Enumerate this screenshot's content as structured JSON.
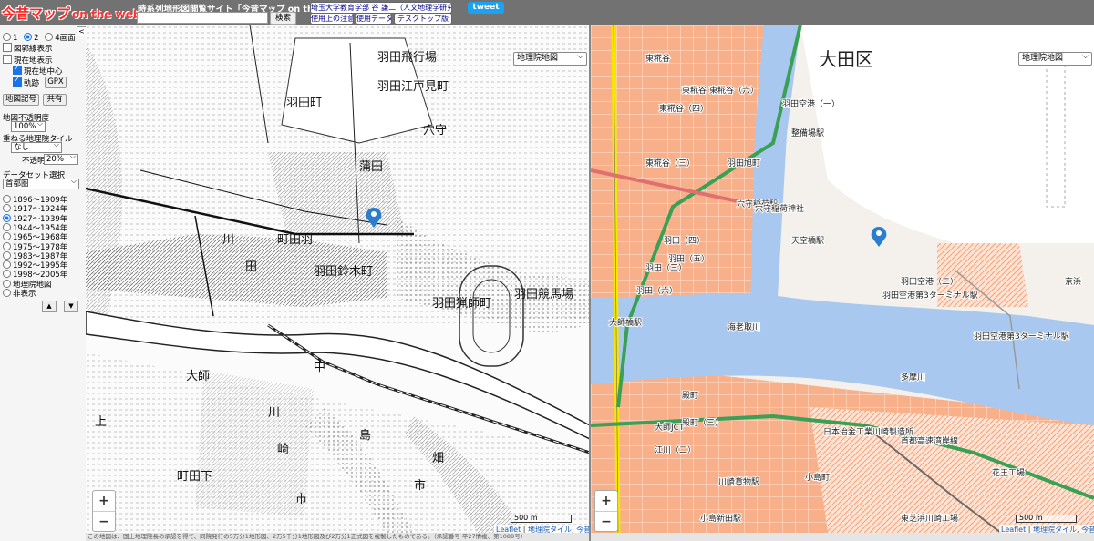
{
  "header": {
    "logo_jp": "今昔マップ",
    "logo_en": "on the web",
    "site_title": "時系列地形図閲覧サイト「今昔マップ on the web」",
    "search_placeholder": "",
    "search_button": "検索",
    "author_link": "埼玉大学教育学部 谷 謙二（人文地理学研究室）",
    "usage_notes": "使用上の注意",
    "data_used": "使用データ",
    "desktop_version": "デスクトップ版",
    "tweet": "tweet"
  },
  "sidebar": {
    "view_options": [
      "1",
      "2",
      "4画面"
    ],
    "view_selected": "2",
    "collapse": "<",
    "checkboxes": [
      {
        "label": "図郭線表示",
        "checked": false
      },
      {
        "label": "現在地表示",
        "checked": false
      },
      {
        "label": "現在地中心",
        "checked": true
      },
      {
        "label": "軌跡",
        "checked": true
      }
    ],
    "gpx_button": "GPX",
    "map_symbols_button": "地図記号",
    "share_button": "共有",
    "opacity_label": "地図不透明度",
    "opacity_value": "100%",
    "overlay_label": "重ねる地理院タイル",
    "overlay_value": "なし",
    "overlay_opacity_label": "不透明度",
    "overlay_opacity_value": "20%",
    "dataset_label": "データセット選択",
    "dataset_value": "首都圏",
    "periods": [
      "1896～1909年",
      "1917～1924年",
      "1927～1939年",
      "1944～1954年",
      "1965～1968年",
      "1975～1978年",
      "1983～1987年",
      "1992～1995年",
      "1998～2005年",
      "地理院地図",
      "非表示"
    ],
    "period_selected": "1927～1939年",
    "up_arrow": "▲",
    "down_arrow": "▼"
  },
  "left_map": {
    "layer_select": "地理院地図",
    "zoom_in": "+",
    "zoom_out": "−",
    "scale": "500 m",
    "attribution": [
      "Leaflet",
      "地理院タイル",
      "今昔マップ"
    ],
    "footer": "この地図は、国土地理院長の承認を得て、同院発行の5万分1地形図、2万5千分1地形図及び2万分1正式図を複製したものである。（承認番号 平27情複、第1088号）",
    "labels": [
      "羽田飛行場",
      "羽田江戸見町",
      "羽田町",
      "穴守",
      "蒲田",
      "羽田競馬場",
      "町田羽",
      "川",
      "羽田鈴木町",
      "田",
      "羽田猟師町",
      "中",
      "大師",
      "上",
      "町田下",
      "川",
      "崎",
      "市",
      "島",
      "畑",
      "市"
    ]
  },
  "right_map": {
    "layer_select": "地理院地図",
    "zoom_in": "+",
    "zoom_out": "−",
    "scale": "500 m",
    "attribution": [
      "Leaflet",
      "地理院タイル",
      "今昔マップ"
    ],
    "labels": [
      "大田区",
      "東糀谷",
      "東糀谷（四）",
      "東糀谷（五）",
      "東糀谷（六）",
      "羽田空港（一）",
      "整備場駅",
      "羽田旭町",
      "穴守稲荷駅",
      "穴守稲荷神社",
      "天空橋駅",
      "羽田（六）",
      "羽田空港（二）",
      "羽田空港第3ターミナル駅",
      "羽田空港第3ターミナル駅",
      "大師橋駅",
      "殿町",
      "多摩川",
      "日本冶金工業川崎製造所",
      "小島町",
      "小島新田駅",
      "川崎貨物駅",
      "首都高速湾岸線",
      "東芝浜川崎工場",
      "花王工場",
      "京浜",
      "海老取川",
      "東糀谷（三）",
      "殿町（三）",
      "江川（二）",
      "大師JCT",
      "羽田（三）",
      "羽田（五）",
      "羽田（四）"
    ]
  },
  "colors": {
    "header_bg": "#727272",
    "sidebar_bg": "#f5f5f5",
    "old_map_ink": "#222222",
    "new_map_land": "#f4f1ec",
    "new_map_water": "#a9c8ef",
    "new_map_urban": "#f8b08a",
    "pin": "#2a7ecc",
    "expressway": "#3aa055",
    "national_road": "#e07070",
    "rail_yellow": "#f6e600"
  }
}
